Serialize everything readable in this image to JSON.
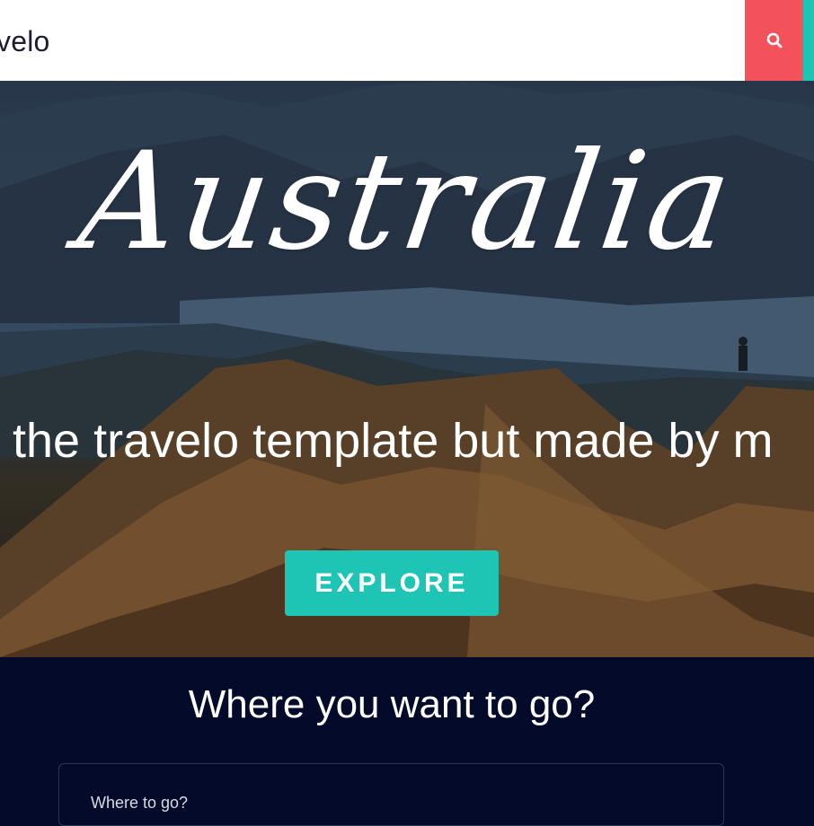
{
  "header": {
    "logo_text": "velo",
    "search_icon": "search-icon",
    "accent_search": "#f4525a",
    "accent_teal": "#1ec4b4"
  },
  "hero": {
    "title": "Australia",
    "subtitle": "the travelo template but made by m",
    "cta_label": "EXPLORE"
  },
  "search_section": {
    "heading": "Where you want to go?",
    "destination_label": "Where to go?"
  },
  "colors": {
    "page_dark": "#040b2a",
    "button_teal": "#1ec4b4",
    "search_red": "#f4525a"
  }
}
